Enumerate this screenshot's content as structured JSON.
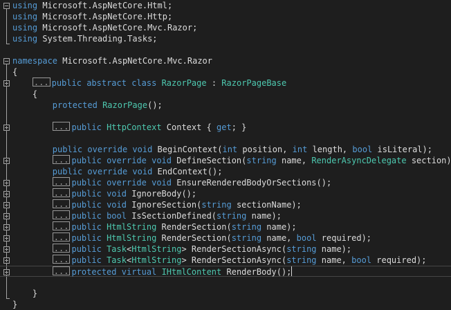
{
  "editor": {
    "colors": {
      "background": "#1e1e1e",
      "keyword": "#569cd6",
      "type": "#4ec9b0",
      "text": "#dcdcdc",
      "outline": "#a5a5a5"
    },
    "lines": [
      {
        "fold": "minus",
        "tokens": [
          {
            "t": "using",
            "c": "kw"
          },
          {
            "t": " Microsoft.AspNetCore.Html;",
            "c": "tx"
          }
        ]
      },
      {
        "tokens": [
          {
            "t": "using",
            "c": "kw"
          },
          {
            "t": " Microsoft.AspNetCore.Http;",
            "c": "tx"
          }
        ]
      },
      {
        "tokens": [
          {
            "t": "using",
            "c": "kw"
          },
          {
            "t": " Microsoft.AspNetCore.Mvc.Razor;",
            "c": "tx"
          }
        ]
      },
      {
        "tokens": [
          {
            "t": "using",
            "c": "kw"
          },
          {
            "t": " System.Threading.Tasks;",
            "c": "tx"
          }
        ]
      },
      {
        "tokens": []
      },
      {
        "fold": "minus",
        "tokens": [
          {
            "t": "namespace",
            "c": "kw"
          },
          {
            "t": " Microsoft.AspNetCore.Mvc.Razor",
            "c": "tx"
          }
        ]
      },
      {
        "tokens": [
          {
            "t": "{",
            "c": "tx"
          }
        ]
      },
      {
        "fold": "plus",
        "tokens": [
          {
            "t": "    ",
            "c": "tx"
          },
          {
            "t": "...",
            "c": "ellipsis"
          },
          {
            "t": "public",
            "c": "kw"
          },
          {
            "t": " ",
            "c": "tx"
          },
          {
            "t": "abstract",
            "c": "kw"
          },
          {
            "t": " ",
            "c": "tx"
          },
          {
            "t": "class",
            "c": "kw"
          },
          {
            "t": " ",
            "c": "tx"
          },
          {
            "t": "RazorPage",
            "c": "ty"
          },
          {
            "t": " : ",
            "c": "tx"
          },
          {
            "t": "RazorPageBase",
            "c": "ty"
          }
        ]
      },
      {
        "tokens": [
          {
            "t": "    {",
            "c": "tx"
          }
        ]
      },
      {
        "tokens": [
          {
            "t": "        ",
            "c": "tx"
          },
          {
            "t": "protected",
            "c": "kw"
          },
          {
            "t": " ",
            "c": "tx"
          },
          {
            "t": "RazorPage",
            "c": "ty"
          },
          {
            "t": "();",
            "c": "tx"
          }
        ]
      },
      {
        "tokens": []
      },
      {
        "fold": "plus",
        "tokens": [
          {
            "t": "        ",
            "c": "tx"
          },
          {
            "t": "...",
            "c": "ellipsis"
          },
          {
            "t": "public",
            "c": "kw"
          },
          {
            "t": " ",
            "c": "tx"
          },
          {
            "t": "HttpContext",
            "c": "ty"
          },
          {
            "t": " Context { ",
            "c": "tx"
          },
          {
            "t": "get",
            "c": "kw"
          },
          {
            "t": "; }",
            "c": "tx"
          }
        ]
      },
      {
        "tokens": []
      },
      {
        "tokens": [
          {
            "t": "        ",
            "c": "tx"
          },
          {
            "t": "public",
            "c": "kw"
          },
          {
            "t": " ",
            "c": "tx"
          },
          {
            "t": "override",
            "c": "kw"
          },
          {
            "t": " ",
            "c": "tx"
          },
          {
            "t": "void",
            "c": "kw"
          },
          {
            "t": " BeginContext(",
            "c": "tx"
          },
          {
            "t": "int",
            "c": "kw"
          },
          {
            "t": " position, ",
            "c": "tx"
          },
          {
            "t": "int",
            "c": "kw"
          },
          {
            "t": " length, ",
            "c": "tx"
          },
          {
            "t": "bool",
            "c": "kw"
          },
          {
            "t": " isLiteral);",
            "c": "tx"
          }
        ]
      },
      {
        "fold": "plus",
        "tokens": [
          {
            "t": "        ",
            "c": "tx"
          },
          {
            "t": "...",
            "c": "ellipsis"
          },
          {
            "t": "public",
            "c": "kw"
          },
          {
            "t": " ",
            "c": "tx"
          },
          {
            "t": "override",
            "c": "kw"
          },
          {
            "t": " ",
            "c": "tx"
          },
          {
            "t": "void",
            "c": "kw"
          },
          {
            "t": " DefineSection(",
            "c": "tx"
          },
          {
            "t": "string",
            "c": "kw"
          },
          {
            "t": " name, ",
            "c": "tx"
          },
          {
            "t": "RenderAsyncDelegate",
            "c": "ty"
          },
          {
            "t": " section);",
            "c": "tx"
          }
        ]
      },
      {
        "tokens": [
          {
            "t": "        ",
            "c": "tx"
          },
          {
            "t": "public",
            "c": "kw"
          },
          {
            "t": " ",
            "c": "tx"
          },
          {
            "t": "override",
            "c": "kw"
          },
          {
            "t": " ",
            "c": "tx"
          },
          {
            "t": "void",
            "c": "kw"
          },
          {
            "t": " EndContext();",
            "c": "tx"
          }
        ]
      },
      {
        "fold": "plus",
        "tokens": [
          {
            "t": "        ",
            "c": "tx"
          },
          {
            "t": "...",
            "c": "ellipsis"
          },
          {
            "t": "public",
            "c": "kw"
          },
          {
            "t": " ",
            "c": "tx"
          },
          {
            "t": "override",
            "c": "kw"
          },
          {
            "t": " ",
            "c": "tx"
          },
          {
            "t": "void",
            "c": "kw"
          },
          {
            "t": " EnsureRenderedBodyOrSections();",
            "c": "tx"
          }
        ]
      },
      {
        "fold": "plus",
        "tokens": [
          {
            "t": "        ",
            "c": "tx"
          },
          {
            "t": "...",
            "c": "ellipsis"
          },
          {
            "t": "public",
            "c": "kw"
          },
          {
            "t": " ",
            "c": "tx"
          },
          {
            "t": "void",
            "c": "kw"
          },
          {
            "t": " IgnoreBody();",
            "c": "tx"
          }
        ]
      },
      {
        "fold": "plus",
        "tokens": [
          {
            "t": "        ",
            "c": "tx"
          },
          {
            "t": "...",
            "c": "ellipsis"
          },
          {
            "t": "public",
            "c": "kw"
          },
          {
            "t": " ",
            "c": "tx"
          },
          {
            "t": "void",
            "c": "kw"
          },
          {
            "t": " IgnoreSection(",
            "c": "tx"
          },
          {
            "t": "string",
            "c": "kw"
          },
          {
            "t": " sectionName);",
            "c": "tx"
          }
        ]
      },
      {
        "fold": "plus",
        "tokens": [
          {
            "t": "        ",
            "c": "tx"
          },
          {
            "t": "...",
            "c": "ellipsis"
          },
          {
            "t": "public",
            "c": "kw"
          },
          {
            "t": " ",
            "c": "tx"
          },
          {
            "t": "bool",
            "c": "kw"
          },
          {
            "t": " IsSectionDefined(",
            "c": "tx"
          },
          {
            "t": "string",
            "c": "kw"
          },
          {
            "t": " name);",
            "c": "tx"
          }
        ]
      },
      {
        "fold": "plus",
        "tokens": [
          {
            "t": "        ",
            "c": "tx"
          },
          {
            "t": "...",
            "c": "ellipsis"
          },
          {
            "t": "public",
            "c": "kw"
          },
          {
            "t": " ",
            "c": "tx"
          },
          {
            "t": "HtmlString",
            "c": "ty"
          },
          {
            "t": " RenderSection(",
            "c": "tx"
          },
          {
            "t": "string",
            "c": "kw"
          },
          {
            "t": " name);",
            "c": "tx"
          }
        ]
      },
      {
        "fold": "plus",
        "tokens": [
          {
            "t": "        ",
            "c": "tx"
          },
          {
            "t": "...",
            "c": "ellipsis"
          },
          {
            "t": "public",
            "c": "kw"
          },
          {
            "t": " ",
            "c": "tx"
          },
          {
            "t": "HtmlString",
            "c": "ty"
          },
          {
            "t": " RenderSection(",
            "c": "tx"
          },
          {
            "t": "string",
            "c": "kw"
          },
          {
            "t": " name, ",
            "c": "tx"
          },
          {
            "t": "bool",
            "c": "kw"
          },
          {
            "t": " required);",
            "c": "tx"
          }
        ]
      },
      {
        "fold": "plus",
        "tokens": [
          {
            "t": "        ",
            "c": "tx"
          },
          {
            "t": "...",
            "c": "ellipsis"
          },
          {
            "t": "public",
            "c": "kw"
          },
          {
            "t": " ",
            "c": "tx"
          },
          {
            "t": "Task",
            "c": "ty"
          },
          {
            "t": "<",
            "c": "tx"
          },
          {
            "t": "HtmlString",
            "c": "ty"
          },
          {
            "t": "> RenderSectionAsync(",
            "c": "tx"
          },
          {
            "t": "string",
            "c": "kw"
          },
          {
            "t": " name);",
            "c": "tx"
          }
        ]
      },
      {
        "fold": "plus",
        "tokens": [
          {
            "t": "        ",
            "c": "tx"
          },
          {
            "t": "...",
            "c": "ellipsis"
          },
          {
            "t": "public",
            "c": "kw"
          },
          {
            "t": " ",
            "c": "tx"
          },
          {
            "t": "Task",
            "c": "ty"
          },
          {
            "t": "<",
            "c": "tx"
          },
          {
            "t": "HtmlString",
            "c": "ty"
          },
          {
            "t": "> RenderSectionAsync(",
            "c": "tx"
          },
          {
            "t": "string",
            "c": "kw"
          },
          {
            "t": " name, ",
            "c": "tx"
          },
          {
            "t": "bool",
            "c": "kw"
          },
          {
            "t": " required);",
            "c": "tx"
          }
        ]
      },
      {
        "fold": "plus",
        "current": true,
        "tokens": [
          {
            "t": "        ",
            "c": "tx"
          },
          {
            "t": "...",
            "c": "ellipsis"
          },
          {
            "t": "protected",
            "c": "kw"
          },
          {
            "t": " ",
            "c": "tx"
          },
          {
            "t": "virtual",
            "c": "kw"
          },
          {
            "t": " ",
            "c": "tx"
          },
          {
            "t": "IHtmlContent",
            "c": "ty"
          },
          {
            "t": " RenderBody();",
            "c": "tx"
          },
          {
            "t": "",
            "c": "caret"
          }
        ]
      },
      {
        "tokens": []
      },
      {
        "tokens": [
          {
            "t": "    }",
            "c": "tx"
          }
        ]
      },
      {
        "tokens": [
          {
            "t": "}",
            "c": "tx"
          }
        ]
      }
    ]
  }
}
